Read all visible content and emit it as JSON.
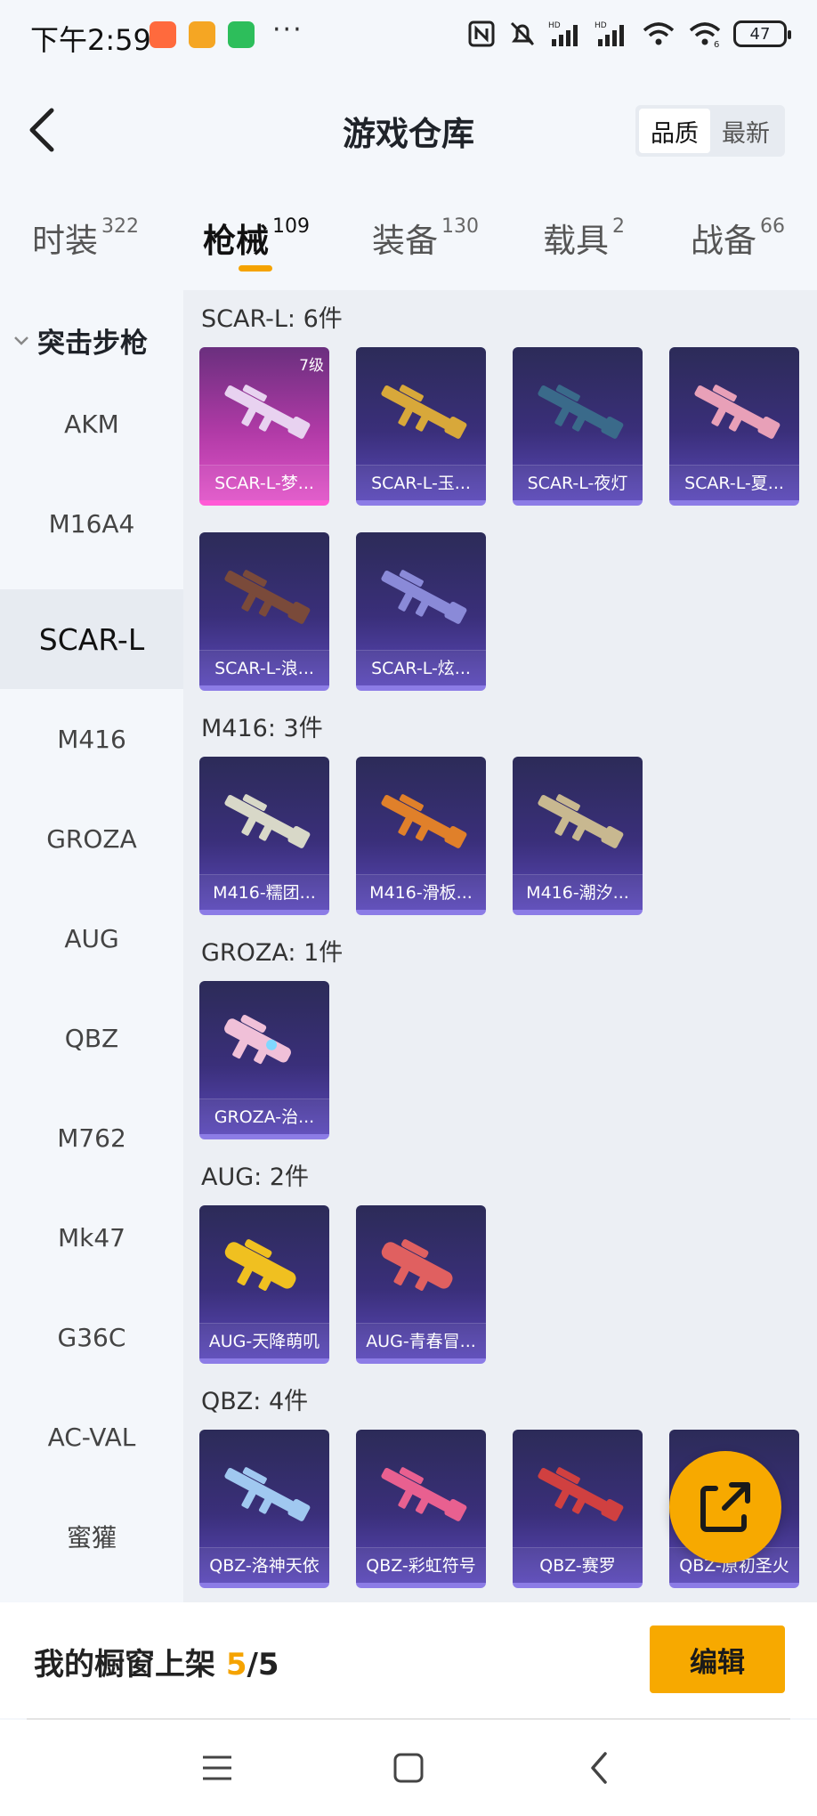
{
  "status_bar": {
    "time": "下午2:59",
    "dots": "···",
    "battery": "47",
    "notification_colors": [
      "#ff6a3d",
      "#f5a623",
      "#2dbe5b"
    ],
    "icons": [
      "nfc-icon",
      "mute-bell-icon",
      "hd-signal-icon",
      "hd-signal-icon",
      "wifi-icon",
      "wifi-6-icon",
      "battery-icon"
    ]
  },
  "header": {
    "title": "游戏仓库",
    "sort_options": [
      "品质",
      "最新"
    ],
    "active_sort": "品质"
  },
  "tabs": [
    {
      "label": "时装",
      "count": "322"
    },
    {
      "label": "枪械",
      "count": "109",
      "active": true
    },
    {
      "label": "装备",
      "count": "130"
    },
    {
      "label": "载具",
      "count": "2"
    },
    {
      "label": "战备",
      "count": "66"
    }
  ],
  "sidebar": {
    "group_label": "突击步枪",
    "items": [
      "AKM",
      "M16A4",
      "SCAR-L",
      "M416",
      "GROZA",
      "AUG",
      "QBZ",
      "M762",
      "Mk47",
      "G36C",
      "AC-VAL",
      "蜜獾"
    ],
    "active": "SCAR-L"
  },
  "sections": [
    {
      "title": "SCAR-L: 6件",
      "items": [
        {
          "name": "SCAR-L-梦...",
          "level": "7级",
          "rarity": "legendary",
          "gun_color": "#e8d2f0"
        },
        {
          "name": "SCAR-L-玉...",
          "rarity": "epic",
          "gun_color": "#d8a83a"
        },
        {
          "name": "SCAR-L-夜灯",
          "rarity": "epic",
          "gun_color": "#3a6a8a"
        },
        {
          "name": "SCAR-L-夏...",
          "rarity": "epic",
          "gun_color": "#e8a0b8"
        },
        {
          "name": "SCAR-L-浪...",
          "rarity": "epic",
          "gun_color": "#5a2e2a"
        },
        {
          "name": "SCAR-L-炫...",
          "rarity": "epic",
          "gun_color": "#8a8ad8"
        }
      ]
    },
    {
      "title": "M416: 3件",
      "items": [
        {
          "name": "M416-糯团...",
          "rarity": "epic",
          "gun_color": "#d8d8c8"
        },
        {
          "name": "M416-滑板...",
          "rarity": "epic",
          "gun_color": "#e0802a"
        },
        {
          "name": "M416-潮汐...",
          "rarity": "epic",
          "gun_color": "#c8b890"
        }
      ]
    },
    {
      "title": "GROZA: 1件",
      "items": [
        {
          "name": "GROZA-治...",
          "rarity": "epic",
          "gun_color": "#f0c0d8"
        }
      ]
    },
    {
      "title": "AUG: 2件",
      "items": [
        {
          "name": "AUG-天降萌叽",
          "rarity": "epic",
          "gun_color": "#f0c020"
        },
        {
          "name": "AUG-青春冒...",
          "rarity": "epic",
          "gun_color": "#e06060"
        }
      ]
    },
    {
      "title": "QBZ: 4件",
      "items": [
        {
          "name": "QBZ-洛神天依",
          "rarity": "epic",
          "gun_color": "#a0c8f0"
        },
        {
          "name": "QBZ-彩虹符号",
          "rarity": "epic",
          "gun_color": "#e86090"
        },
        {
          "name": "QBZ-赛罗",
          "rarity": "epic",
          "gun_color": "#d04040"
        },
        {
          "name": "QBZ-原初圣火",
          "rarity": "epic",
          "gun_color": "#c8c8d8"
        }
      ]
    }
  ],
  "bottom": {
    "label": "我的橱窗上架 ",
    "count": "5",
    "total": "/5",
    "edit_label": "编辑"
  },
  "colors": {
    "accent": "#f7a900",
    "epic_card": "#3a2f7a",
    "legendary_card": "#b03aa6"
  }
}
